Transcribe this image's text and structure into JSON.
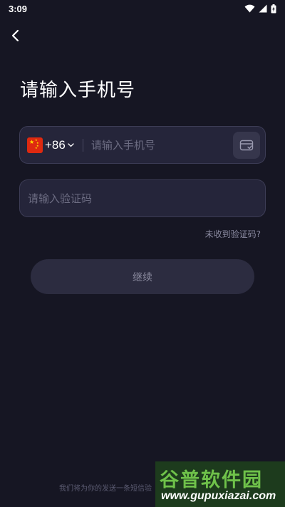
{
  "status_bar": {
    "time": "3:09",
    "icons": [
      "wifi-icon",
      "cellular-signal-icon",
      "battery-charging-icon"
    ]
  },
  "nav": {
    "back_icon": "chevron-left-icon"
  },
  "page": {
    "title": "请输入手机号"
  },
  "phone_field": {
    "country_flag": "china-flag-icon",
    "country_code": "+86",
    "dropdown_icon": "chevron-down-icon",
    "value": "",
    "placeholder": "请输入手机号",
    "contact_icon": "contacts-book-icon"
  },
  "code_field": {
    "value": "",
    "placeholder": "请输入验证码"
  },
  "no_code_link": "未收到验证码?",
  "continue_button": "继续",
  "footer_note": "我们将为你的发送一条短信验",
  "watermark": {
    "logo": "谷普软件园",
    "url": "www.gupuxiazai.com"
  },
  "colors": {
    "background": "#161623",
    "field_background": "#25253a",
    "field_border": "#3c3c55",
    "button_background": "#2c2c40",
    "placeholder_text": "#6c6c82",
    "watermark_green": "#6fc24a"
  }
}
